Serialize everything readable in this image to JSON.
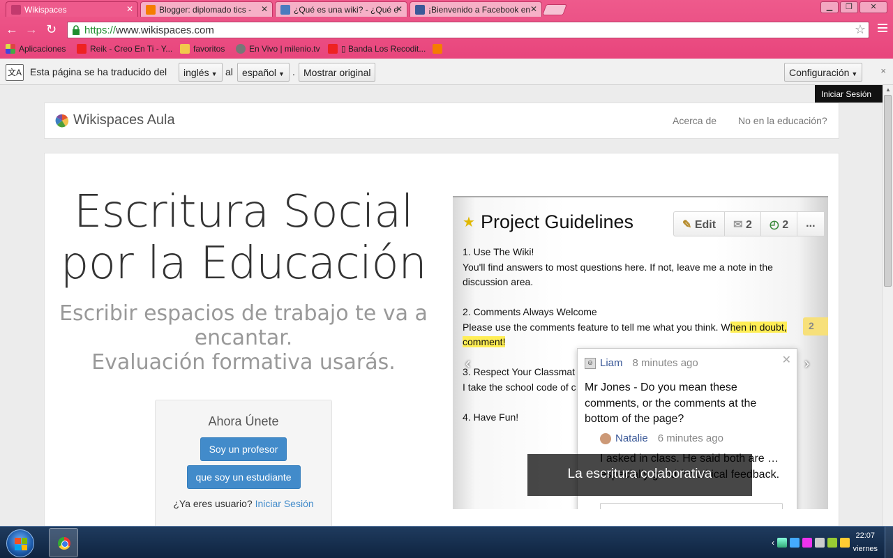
{
  "browser": {
    "tabs": [
      {
        "label": "Wikispaces",
        "color": "#c23a6e"
      },
      {
        "label": "Blogger: diplomado tics -",
        "color": "#f57d00"
      },
      {
        "label": "¿Qué es una wiki? - ¿Qué e",
        "color": "#4a7bbf"
      },
      {
        "label": "¡Bienvenido a Facebook en",
        "color": "#3b5998"
      }
    ],
    "url_scheme": "https://",
    "url_rest": "www.wikispaces.com",
    "bookmarks": [
      {
        "label": "Aplicaciones",
        "color": "#d44"
      },
      {
        "label": "Reik - Creo En Ti - Y...",
        "color": "#e22"
      },
      {
        "label": "favoritos",
        "color": "#f2c94c"
      },
      {
        "label": "En Vivo | milenio.tv",
        "color": "#777"
      },
      {
        "label": "▯ Banda Los Recodit...",
        "color": "#e22"
      },
      {
        "label": "",
        "color": "#f57d00"
      }
    ]
  },
  "translate_bar": {
    "text": "Esta página se ha traducido del",
    "from_lang": "inglés",
    "to_word": "al",
    "to_lang": "español",
    "dot": ".",
    "show_original": "Mostrar original",
    "settings": "Configuración",
    "close": "×"
  },
  "tooltip": "Iniciar Sesión",
  "site": {
    "logo": "Wikispaces Aula",
    "nav": [
      "Acerca de",
      "No en la educación?"
    ],
    "headline_line1": "Escritura Social",
    "headline_line2": "por la Educación",
    "sub_line1": "Escribir espacios de trabajo te va a",
    "sub_line2": "encantar.",
    "sub_line3": "Evaluación formativa usarás.",
    "join": {
      "title": "Ahora Únete",
      "teacher_button": "Soy un profesor",
      "student_button": "que soy un estudiante",
      "already_user": "¿Ya eres usuario?",
      "login_link": "Iniciar Sesión"
    }
  },
  "carousel": {
    "page_title": "Project Guidelines",
    "toolbar": {
      "edit": "Edit",
      "comments_count": "2",
      "history_count": "2",
      "more": "..."
    },
    "items": [
      "1. Use The Wiki!",
      "You'll find answers to most questions here. If not, leave me a note in the",
      "discussion area.",
      "2. Comments Always Welcome",
      "Please use the comments feature to tell me what you think. W",
      "hen in doubt,",
      "comment!",
      "3. Respect Your Classmat",
      "I take the school code of c",
      "4. Have Fun!"
    ],
    "badge_count": "2",
    "comment": {
      "author": "Liam",
      "time": "8 minutes ago",
      "text": "Mr Jones - Do you mean these comments, or the comments at the bottom of the page?",
      "reply_author": "Natalie",
      "reply_time": "6 minutes ago",
      "reply_text": "I asked in class. He said both are … especially good for critical feedback."
    },
    "caption": "La escritura colaborativa"
  },
  "taskbar": {
    "time": "22:07",
    "day": "viernes"
  }
}
